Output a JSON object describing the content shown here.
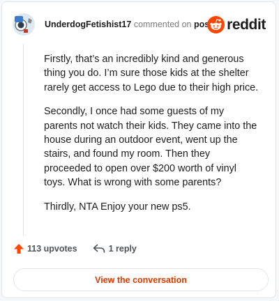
{
  "comment": {
    "author": "UnderdogFetishist17",
    "action_text": "commented on",
    "post_link": "post",
    "paragraphs": [
      "Firstly, that’s an incredibly kind and generous thing you do. I’m sure those kids at the shelter rarely get access to Lego due to their high price.",
      "Secondly, I once had some guests of my parents not watch their kids. They came into the house during an outdoor event, went up the stairs, and found my room. Then they proceeded to open over $200 worth of vinyl toys. What is wrong with some parents?",
      "Thirdly, NTA Enjoy your new ps5."
    ]
  },
  "brand": {
    "logo_text": "reddit",
    "color": "#ff4500"
  },
  "actions": {
    "upvotes": "113 upvotes",
    "replies": "1 reply"
  },
  "cta": {
    "label": "View the conversation",
    "color": "#d93a00"
  },
  "icons": [
    "avatar",
    "reddit-logo-icon",
    "upvote-arrow-icon",
    "reply-icon"
  ]
}
